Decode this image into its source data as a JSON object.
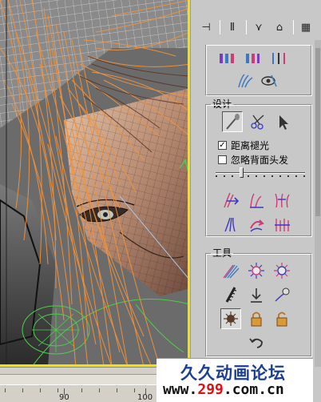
{
  "toolbar": {
    "buttons": [
      {
        "icon": "pin-stack-icon",
        "glyph": "⊣"
      },
      {
        "icon": "pause-bars-icon",
        "glyph": "Ⅱ"
      },
      {
        "icon": "funnel-icon",
        "glyph": "⋎"
      },
      {
        "icon": "lock-icon",
        "glyph": "⌂"
      },
      {
        "icon": "configure-sets-icon",
        "glyph": "▦"
      }
    ]
  },
  "design": {
    "title": "设计",
    "distance_fade_label": "距离褪光",
    "distance_fade_checked": true,
    "ignore_back_hair_label": "忽略背面头发",
    "ignore_back_hair_checked": false,
    "slider_level": 0.28
  },
  "tools": {
    "title": "工具"
  },
  "timeline": {
    "labels": [
      "90",
      "100"
    ]
  },
  "watermark": {
    "title": "久久动画论坛",
    "url_prefix": "www.",
    "url_number": "299",
    "url_suffix": ".com.cn"
  },
  "colors": {
    "viewport_border": "#f2e400",
    "hair_orange": "#f2923a",
    "mesh_lines": "#d0d0d0",
    "watermark_title": "#1b3f95",
    "watermark_number": "#e01010",
    "panel_bg": "#c8c8c8"
  }
}
